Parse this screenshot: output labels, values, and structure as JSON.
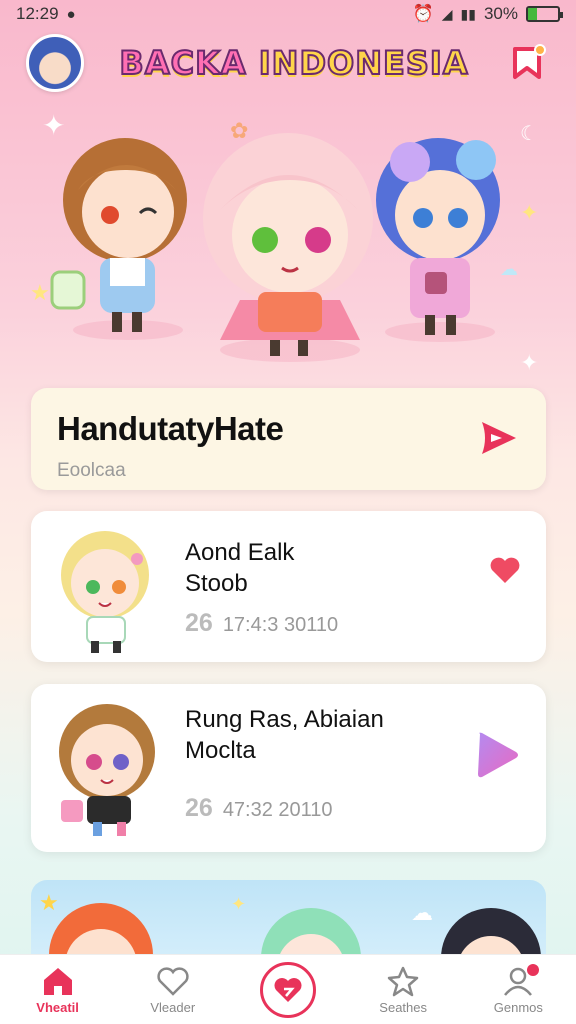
{
  "status_bar": {
    "time": "12:29",
    "battery_text": "30%",
    "battery_level": 0.3
  },
  "header": {
    "title_part1": "BACKA",
    "title_part2": "INDONESIA",
    "avatar_icon": "user-avatar",
    "notification_icon": "bookmark-bell-icon"
  },
  "feature": {
    "title": "HandutatyHate",
    "subtitle": "Eoolcaa",
    "action_icon": "play-icon",
    "accent": "#e8335a"
  },
  "list": [
    {
      "title": "Aond Ealk\nStoob",
      "count": "26",
      "meta": "17:4:3 30110",
      "action_icon": "heart-icon"
    },
    {
      "title": "Rung Ras, Abiaian\nMoclta",
      "count": "26",
      "meta": "47:32 20110",
      "action_icon": "play-icon"
    }
  ],
  "nav": {
    "items": [
      {
        "label": "Vheatil",
        "icon": "home-icon",
        "active": true
      },
      {
        "label": "Vleader",
        "icon": "heart-outline-icon",
        "active": false
      },
      {
        "label": "",
        "icon": "center-heart-icon",
        "active": false
      },
      {
        "label": "Seathes",
        "icon": "star-icon",
        "active": false
      },
      {
        "label": "Genmos",
        "icon": "profile-icon",
        "active": false
      }
    ]
  },
  "colors": {
    "accent": "#e8335a",
    "title_pink": "#ff6fb3",
    "title_yellow": "#ffd54a",
    "card_bg": "#fdf6e4"
  }
}
